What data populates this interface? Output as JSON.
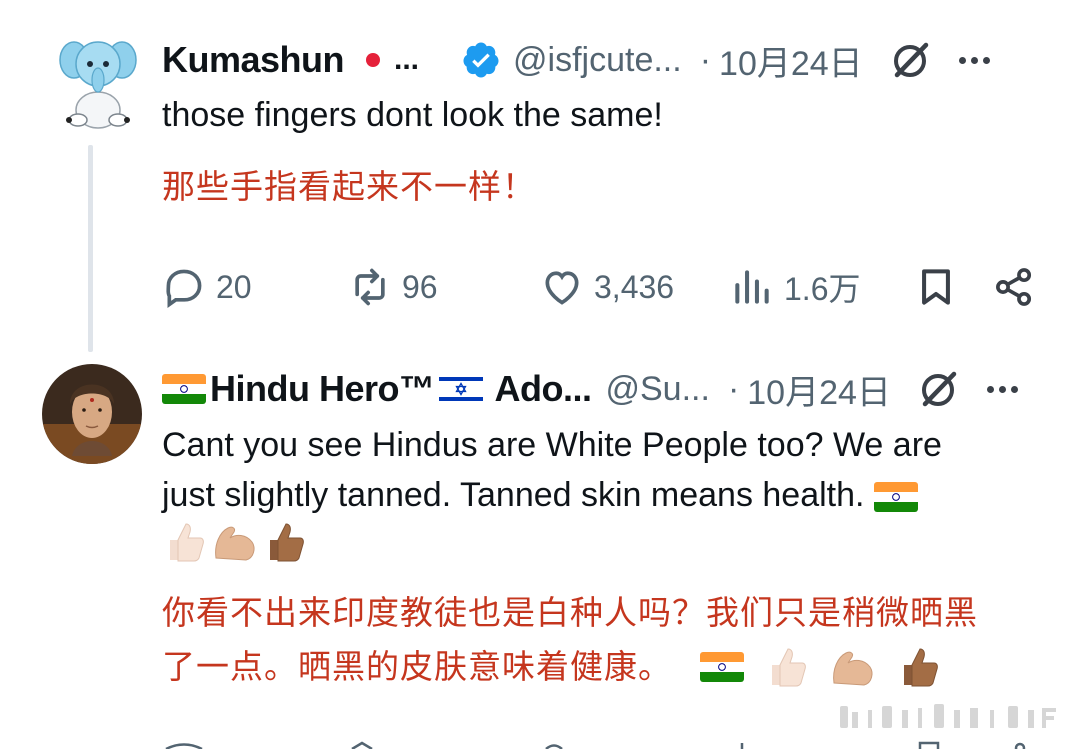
{
  "tweet1": {
    "display_name": "Kumashun",
    "name_ellipsis": "...",
    "handle": "@isfjcute...",
    "separator": "·",
    "date": "10月24日",
    "text": "those fingers dont look the same!",
    "translation": "那些手指看起来不一样！",
    "stats": {
      "replies": "20",
      "reposts": "96",
      "likes": "3,436",
      "views": "1.6万"
    }
  },
  "tweet2": {
    "display_name": "Hindu Hero™",
    "display_name_tail": "Ado...",
    "handle": "@Su...",
    "separator": "·",
    "date": "10月24日",
    "text_line1": "Cant you see Hindus are White People too? We are",
    "text_line2": "just slightly tanned. Tanned skin means health.",
    "translation_line1": "你看不出来印度教徒也是白种人吗？我们只是稍微晒黑",
    "translation_line2": "了一点。晒黑的皮肤意味着健康。"
  },
  "colors": {
    "accent_verified": "#1d9bf0",
    "translation_text": "#c5361e",
    "muted": "#536471",
    "red_dot": "#e5213a"
  },
  "icons": [
    "verified-badge-icon",
    "grok-icon",
    "more-icon",
    "reply-icon",
    "repost-icon",
    "like-icon",
    "views-icon",
    "bookmark-icon",
    "share-icon",
    "india-flag-icon",
    "israel-flag-icon",
    "thumbs-up-icon",
    "flexed-biceps-icon"
  ]
}
